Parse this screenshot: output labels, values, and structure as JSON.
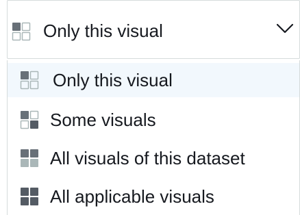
{
  "select": {
    "value": "Only this visual",
    "icon": "grid-one-filled-icon",
    "chevron_icon": "chevron-down-icon"
  },
  "options": [
    {
      "label": "Only this visual",
      "icon": "grid-one-filled-icon",
      "selected": true,
      "filled_cells": [
        0
      ]
    },
    {
      "label": "Some visuals",
      "icon": "grid-two-filled-icon",
      "selected": false,
      "filled_cells": [
        0,
        3
      ]
    },
    {
      "label": "All visuals of this dataset",
      "icon": "grid-top-filled-icon",
      "selected": false,
      "filled_cells": [
        0,
        1,
        2,
        3
      ]
    },
    {
      "label": "All applicable visuals",
      "icon": "grid-all-filled-icon",
      "selected": false,
      "filled_cells": [
        0,
        1,
        2,
        3
      ]
    }
  ],
  "colors": {
    "icon_filled": "#687078",
    "icon_filled_dark": "#545b64",
    "icon_empty_stroke": "#aab7b8",
    "selected_bg": "#f2f8fd",
    "border": "#d5dbdb"
  }
}
